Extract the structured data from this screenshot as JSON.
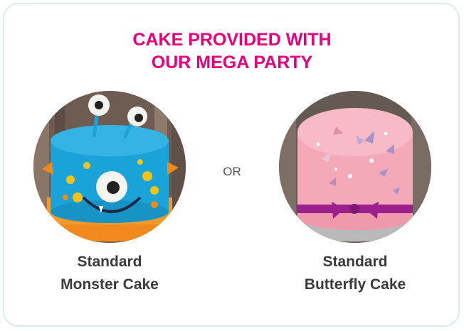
{
  "heading": {
    "line1": "CAKE PROVIDED WITH",
    "line2": "OUR MEGA PARTY"
  },
  "separator": "OR",
  "options": [
    {
      "image": "monster-cake-photo",
      "caption_line1": "Standard",
      "caption_line2": "Monster Cake"
    },
    {
      "image": "butterfly-cake-photo",
      "caption_line1": "Standard",
      "caption_line2": "Butterfly Cake"
    }
  ],
  "colors": {
    "heading": "#e6007e",
    "caption": "#3b3b3b",
    "border": "#dbe9f5",
    "monster_body": "#1aa3d9",
    "butterfly_body": "#f4a9b8",
    "ribbon": "#9b1f8e"
  }
}
